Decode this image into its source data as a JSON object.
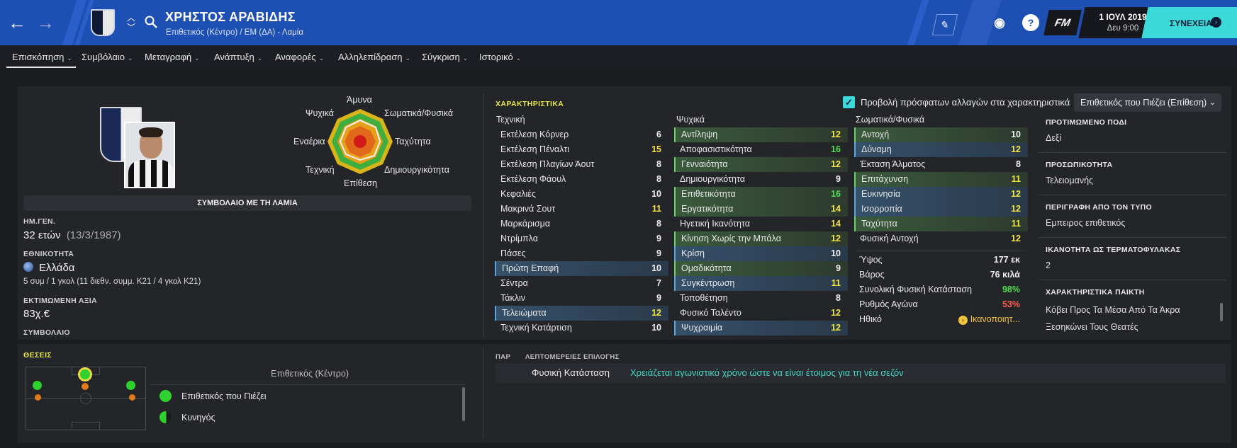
{
  "header": {
    "player_name": "ΧΡΗΣΤΟΣ ΑΡΑΒΙΔΗΣ",
    "player_subtitle": "Επιθετικός (Κέντρο) / ΕΜ (ΔΑ) - Λαμία",
    "date": "1 ΙΟΥΛ 2019",
    "day_time": "Δευ 9:00",
    "continue_label": "ΣΥΝΕΧΕΙΑ",
    "fm_logo": "FM",
    "colors": {
      "header_bg": "#1e4fb2",
      "accent": "#3bd9d9"
    },
    "icons": [
      "back-arrow-icon",
      "forward-arrow-icon",
      "club-badge-icon",
      "updown-chevron-icon",
      "search-icon",
      "edit-icon",
      "world-icon",
      "help-icon"
    ]
  },
  "tabs": [
    {
      "label": "Επισκόπηση"
    },
    {
      "label": "Συμβόλαιο"
    },
    {
      "label": "Μεταγραφή"
    },
    {
      "label": "Ανάπτυξη"
    },
    {
      "label": "Αναφορές"
    },
    {
      "label": "Αλληλεπίδραση"
    },
    {
      "label": "Σύγκριση"
    },
    {
      "label": "Ιστορικό"
    }
  ],
  "profile": {
    "contract": "ΣΥΜΒΟΛΑΙΟ ΜΕ ΤΗ ΛΑΜΙΑ",
    "dob_label": "ΗΜ.ΓΕΝ.",
    "age": "32 ετών",
    "dob": "(13/3/1987)",
    "nationality_label": "ΕΘΝΙΚΟΤΗΤΑ",
    "nationality": "Ελλάδα",
    "caps": "5 συμ / 1 γκολ (11 διεθν. συμμ. Κ21 / 4 γκολ Κ21)",
    "value_label": "ΕΚΤΙΜΩΜΕΝΗ ΑΞΙΑ",
    "value": "83χ.€",
    "contract_label": "ΣΥΜΒΟΛΑΙΟ"
  },
  "radar": {
    "labels": {
      "defense": "Άμυνα",
      "physical": "Σωματικά/Φυσικά",
      "speed": "Ταχύτητα",
      "creativity": "Δημιουργικότητα",
      "attack": "Επίθεση",
      "technique": "Τεχνική",
      "aerial": "Εναέρια",
      "mental": "Ψυχικά"
    }
  },
  "attributes": {
    "title": "ΧΑΡΑΚΤΗΡΙΣΤΙΚΑ",
    "show_changes_label": "Προβολή πρόσφατων αλλαγών στα χαρακτηριστικά",
    "role_dropdown": "Επιθετικός που Πιέζει (Επίθεση)",
    "technical_title": "Τεχνική",
    "mental_title": "Ψυχικά",
    "physical_title": "Σωματικά/Φυσικά",
    "technical": [
      {
        "name": "Εκτέλεση Κόρνερ",
        "value": "6",
        "hl": ""
      },
      {
        "name": "Εκτέλεση Πέναλτι",
        "value": "15",
        "hl": ""
      },
      {
        "name": "Εκτέλεση Πλαγίων Άουτ",
        "value": "8",
        "hl": ""
      },
      {
        "name": "Εκτέλεση Φάουλ",
        "value": "8",
        "hl": ""
      },
      {
        "name": "Κεφαλιές",
        "value": "10",
        "hl": ""
      },
      {
        "name": "Μακρινά Σουτ",
        "value": "11",
        "hl": ""
      },
      {
        "name": "Μαρκάρισμα",
        "value": "8",
        "hl": ""
      },
      {
        "name": "Ντρίμπλα",
        "value": "9",
        "hl": ""
      },
      {
        "name": "Πάσες",
        "value": "9",
        "hl": ""
      },
      {
        "name": "Πρώτη Επαφή",
        "value": "10",
        "hl": "blue"
      },
      {
        "name": "Σέντρα",
        "value": "7",
        "hl": ""
      },
      {
        "name": "Τάκλιν",
        "value": "9",
        "hl": ""
      },
      {
        "name": "Τελειώματα",
        "value": "12",
        "hl": "blue"
      },
      {
        "name": "Τεχνική Κατάρτιση",
        "value": "10",
        "hl": ""
      }
    ],
    "mental": [
      {
        "name": "Αντίληψη",
        "value": "12",
        "hl": "green"
      },
      {
        "name": "Αποφασιστικότητα",
        "value": "16",
        "hl": ""
      },
      {
        "name": "Γενναιότητα",
        "value": "12",
        "hl": "green"
      },
      {
        "name": "Δημιουργικότητα",
        "value": "9",
        "hl": ""
      },
      {
        "name": "Επιθετικότητα",
        "value": "16",
        "hl": "green"
      },
      {
        "name": "Εργατικότητα",
        "value": "14",
        "hl": "green"
      },
      {
        "name": "Ηγετική Ικανότητα",
        "value": "14",
        "hl": ""
      },
      {
        "name": "Κίνηση Χωρίς την Μπάλα",
        "value": "12",
        "hl": "green"
      },
      {
        "name": "Κρίση",
        "value": "10",
        "hl": "blue"
      },
      {
        "name": "Ομαδικότητα",
        "value": "9",
        "hl": "green"
      },
      {
        "name": "Συγκέντρωση",
        "value": "11",
        "hl": "blue"
      },
      {
        "name": "Τοποθέτηση",
        "value": "8",
        "hl": ""
      },
      {
        "name": "Φυσικό Ταλέντο",
        "value": "12",
        "hl": ""
      },
      {
        "name": "Ψυχραιμία",
        "value": "12",
        "hl": "blue"
      }
    ],
    "physical": [
      {
        "name": "Αντοχή",
        "value": "10",
        "hl": "green"
      },
      {
        "name": "Δύναμη",
        "value": "12",
        "hl": "blue"
      },
      {
        "name": "Έκταση Άλματος",
        "value": "8",
        "hl": ""
      },
      {
        "name": "Επιτάχυνση",
        "value": "11",
        "hl": "green"
      },
      {
        "name": "Ευκινησία",
        "value": "12",
        "hl": "blue"
      },
      {
        "name": "Ισορροπία",
        "value": "12",
        "hl": "blue"
      },
      {
        "name": "Ταχύτητα",
        "value": "11",
        "hl": "green"
      },
      {
        "name": "Φυσική Αντοχή",
        "value": "12",
        "hl": ""
      }
    ]
  },
  "stats": {
    "height_label": "Ύψος",
    "height": "177 εκ",
    "weight_label": "Βάρος",
    "weight": "76 κιλά",
    "condition_label": "Συνολική Φυσική Κατάσταση",
    "condition": "98%",
    "sharpness_label": "Ρυθμός Αγώνα",
    "sharpness": "53%",
    "morale_label": "Ηθικό",
    "morale": "Ικανοποιητ..."
  },
  "info": {
    "foot_title": "ΠΡΟΤΙΜΩΜΕΝΟ ΠΟΔΙ",
    "foot": "Δεξί",
    "personality_title": "ΠΡΟΣΩΠΙΚΟΤΗΤΑ",
    "personality": "Τελειομανής",
    "media_title": "ΠΕΡΙΓΡΑΦΗ ΑΠΟ ΤΟΝ ΤΥΠΟ",
    "media": "Εμπειρος επιθετικός",
    "gk_title": "ΙΚΑΝΟΤΗΤΑ ΩΣ ΤΕΡΜΑΤΟΦΥΛΑΚΑΣ",
    "gk": "2",
    "traits_title": "ΧΑΡΑΚΤΗΡΙΣΤΙΚΑ ΠΑΙΚΤΗ",
    "trait1": "Κόβει Προς Τα Μέσα Από Τα Άκρα",
    "trait2": "Ξεσηκώνει Τους Θεατές"
  },
  "positions": {
    "title": "ΘΕΣΕΙΣ",
    "main_position": "Επιθετικός (Κέντρο)",
    "role1": "Επιθετικός που Πιέζει",
    "role2": "Κυνηγός"
  },
  "selection": {
    "par": "ΠΑΡ",
    "details_title": "ΛΕΠΤΟΜΕΡΕΙΕΣ ΕΠΙΛΟΓΗΣ",
    "key": "Φυσική Κατάσταση",
    "value": "Χρειάζεται αγωνιστικό χρόνο ώστε να είναι έτοιμος για τη νέα σεζόν"
  }
}
